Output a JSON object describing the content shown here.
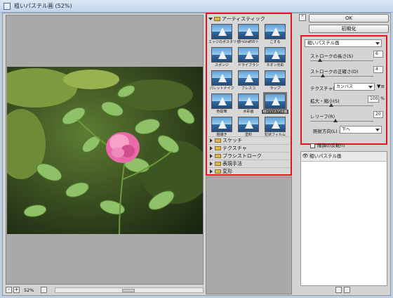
{
  "window": {
    "title": "粗いパステル画 (52%)"
  },
  "preview": {
    "zoom": "52%",
    "zoom_out": "-",
    "zoom_in": "+"
  },
  "gallery": {
    "open_folder": "アーティスティック",
    "filters": [
      {
        "label": "エッジのポスタリゼーション"
      },
      {
        "label": "カットアウト"
      },
      {
        "label": "こする"
      },
      {
        "label": "スポンジ"
      },
      {
        "label": "ドライブラシ"
      },
      {
        "label": "ネオン光彩"
      },
      {
        "label": "パレットナイフ"
      },
      {
        "label": "フレスコ"
      },
      {
        "label": "ラップ"
      },
      {
        "label": "色鉛筆"
      },
      {
        "label": "水彩画"
      },
      {
        "label": "粗いパステル画",
        "selected": true
      },
      {
        "label": "粗描き"
      },
      {
        "label": "塗料"
      },
      {
        "label": "粒状フィルム"
      }
    ],
    "folders": [
      "スケッチ",
      "テクスチャ",
      "ブラシストローク",
      "表現手法",
      "変形"
    ]
  },
  "buttons": {
    "ok": "OK",
    "default": "初期化"
  },
  "settings": {
    "filter_select": "粗いパステル画",
    "stroke_length_label": "ストロークの長さ(S)",
    "stroke_length_value": "6",
    "stroke_length_max": 40,
    "stroke_detail_label": "ストロークの正確さ(D)",
    "stroke_detail_value": "4",
    "stroke_detail_max": 20,
    "texture_label": "テクスチャ(T) :",
    "texture_value": "カンバス",
    "texture_menu": "▼≡",
    "scaling_label": "拡大・縮小(S)",
    "scaling_value": "100",
    "scaling_unit": "%",
    "scaling_min": 50,
    "scaling_max": 200,
    "relief_label": "レリーフ(R)",
    "relief_value": "20",
    "relief_max": 50,
    "light_label": "照射方向(L) :",
    "light_value": "下へ",
    "invert_label": "階調の反転(I)"
  },
  "layers": [
    {
      "name": "粗いパステル画",
      "visible": true
    }
  ],
  "colors": {
    "highlight": "#e8141b"
  }
}
